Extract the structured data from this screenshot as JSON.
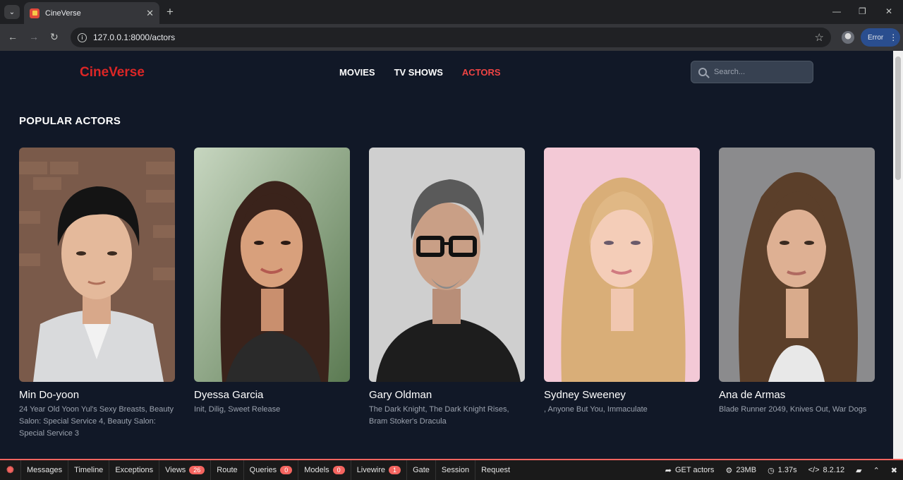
{
  "browser": {
    "tab_title": "CineVerse",
    "url": "127.0.0.1:8000/actors",
    "error_label": "Error"
  },
  "site": {
    "brand": "CineVerse",
    "nav": [
      {
        "label": "MOVIES"
      },
      {
        "label": "TV SHOWS"
      },
      {
        "label": "ACTORS"
      }
    ],
    "search_placeholder": "Search..."
  },
  "section_title": "POPULAR ACTORS",
  "actors": [
    {
      "name": "Min Do-yoon",
      "known_for": "24 Year Old Yoon Yul's Sexy Breasts, Beauty Salon: Special Service 4, Beauty Salon: Special Service 3"
    },
    {
      "name": "Dyessa Garcia",
      "known_for": "Init, Dilig, Sweet Release"
    },
    {
      "name": "Gary Oldman",
      "known_for": "The Dark Knight, The Dark Knight Rises, Bram Stoker's Dracula"
    },
    {
      "name": "Sydney Sweeney",
      "known_for": ", Anyone But You, Immaculate"
    },
    {
      "name": "Ana de Armas",
      "known_for": "Blade Runner 2049, Knives Out, War Dogs"
    }
  ],
  "debugbar": {
    "items": [
      {
        "label": "Messages"
      },
      {
        "label": "Timeline"
      },
      {
        "label": "Exceptions"
      },
      {
        "label": "Views",
        "badge": "26"
      },
      {
        "label": "Route"
      },
      {
        "label": "Queries",
        "badge": "0"
      },
      {
        "label": "Models",
        "badge": "0"
      },
      {
        "label": "Livewire",
        "badge": "1"
      },
      {
        "label": "Gate"
      },
      {
        "label": "Session"
      },
      {
        "label": "Request"
      }
    ],
    "route": "GET actors",
    "memory": "23MB",
    "time": "1.37s",
    "php_version": "8.2.12"
  },
  "colors": {
    "accent": "#dc2626",
    "background": "#111827",
    "debug_accent": "#f4645f"
  }
}
